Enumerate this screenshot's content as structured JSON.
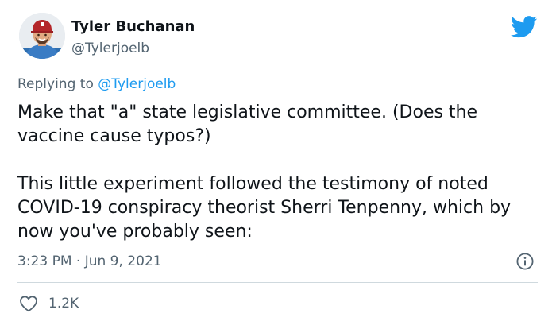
{
  "author": {
    "name": "Tyler Buchanan",
    "handle": "@Tylerjoelb",
    "avatar_icon": "avatar-photo"
  },
  "platform_icon": "twitter-bird-icon",
  "reply": {
    "prefix": "Replying to",
    "handle": "@Tylerjoelb"
  },
  "text": {
    "paragraph_1": "Make that \"a\" state legislative committee. (Does the vaccine cause typos?)",
    "paragraph_2": "This little experiment followed the testimony of noted COVID-19 conspiracy theorist Sherri Tenpenny, which by now you've probably seen:"
  },
  "meta": {
    "time": "3:23 PM",
    "separator": "·",
    "date": "Jun 9, 2021",
    "info_icon": "info-icon"
  },
  "engagement": {
    "like_icon": "heart-icon",
    "likes": "1.2K"
  },
  "colors": {
    "accent": "#1d9bf0",
    "text": "#0f1419",
    "muted": "#536471",
    "divider": "#cfd9de"
  }
}
